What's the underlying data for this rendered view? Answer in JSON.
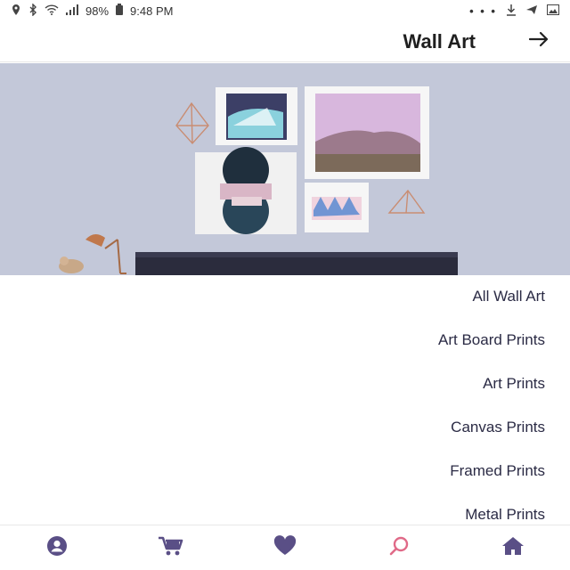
{
  "status_bar": {
    "time": "9:48 PM",
    "battery": "98%",
    "more_dots": "• • •"
  },
  "header": {
    "title": "Wall Art",
    "nav_icon": "arrow-right-icon"
  },
  "hero": {
    "description_icon": "wall-art-photo"
  },
  "categories": [
    {
      "label": "All Wall Art"
    },
    {
      "label": "Art Board Prints"
    },
    {
      "label": "Art Prints"
    },
    {
      "label": "Canvas Prints"
    },
    {
      "label": "Framed Prints"
    },
    {
      "label": "Metal Prints"
    }
  ],
  "bottom_nav": [
    {
      "icon": "profile-icon"
    },
    {
      "icon": "cart-icon"
    },
    {
      "icon": "heart-icon"
    },
    {
      "icon": "search-icon"
    },
    {
      "icon": "home-icon"
    }
  ],
  "colors": {
    "nav_purple": "#5a4f86",
    "search_pink": "#e06a88",
    "title": "#1f1f1f",
    "list_text": "#2b2b45"
  }
}
